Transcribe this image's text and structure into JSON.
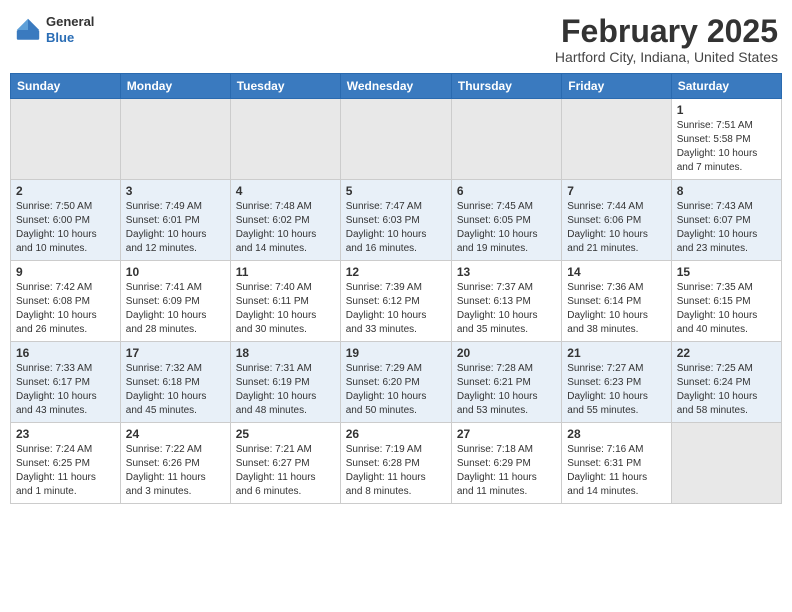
{
  "header": {
    "logo": {
      "general": "General",
      "blue": "Blue"
    },
    "title": "February 2025",
    "location": "Hartford City, Indiana, United States"
  },
  "calendar": {
    "days_of_week": [
      "Sunday",
      "Monday",
      "Tuesday",
      "Wednesday",
      "Thursday",
      "Friday",
      "Saturday"
    ],
    "weeks": [
      {
        "id": "week1",
        "days": [
          {
            "num": "",
            "info": ""
          },
          {
            "num": "",
            "info": ""
          },
          {
            "num": "",
            "info": ""
          },
          {
            "num": "",
            "info": ""
          },
          {
            "num": "",
            "info": ""
          },
          {
            "num": "",
            "info": ""
          },
          {
            "num": "1",
            "info": "Sunrise: 7:51 AM\nSunset: 5:58 PM\nDaylight: 10 hours\nand 7 minutes."
          }
        ]
      },
      {
        "id": "week2",
        "days": [
          {
            "num": "2",
            "info": "Sunrise: 7:50 AM\nSunset: 6:00 PM\nDaylight: 10 hours\nand 10 minutes."
          },
          {
            "num": "3",
            "info": "Sunrise: 7:49 AM\nSunset: 6:01 PM\nDaylight: 10 hours\nand 12 minutes."
          },
          {
            "num": "4",
            "info": "Sunrise: 7:48 AM\nSunset: 6:02 PM\nDaylight: 10 hours\nand 14 minutes."
          },
          {
            "num": "5",
            "info": "Sunrise: 7:47 AM\nSunset: 6:03 PM\nDaylight: 10 hours\nand 16 minutes."
          },
          {
            "num": "6",
            "info": "Sunrise: 7:45 AM\nSunset: 6:05 PM\nDaylight: 10 hours\nand 19 minutes."
          },
          {
            "num": "7",
            "info": "Sunrise: 7:44 AM\nSunset: 6:06 PM\nDaylight: 10 hours\nand 21 minutes."
          },
          {
            "num": "8",
            "info": "Sunrise: 7:43 AM\nSunset: 6:07 PM\nDaylight: 10 hours\nand 23 minutes."
          }
        ]
      },
      {
        "id": "week3",
        "days": [
          {
            "num": "9",
            "info": "Sunrise: 7:42 AM\nSunset: 6:08 PM\nDaylight: 10 hours\nand 26 minutes."
          },
          {
            "num": "10",
            "info": "Sunrise: 7:41 AM\nSunset: 6:09 PM\nDaylight: 10 hours\nand 28 minutes."
          },
          {
            "num": "11",
            "info": "Sunrise: 7:40 AM\nSunset: 6:11 PM\nDaylight: 10 hours\nand 30 minutes."
          },
          {
            "num": "12",
            "info": "Sunrise: 7:39 AM\nSunset: 6:12 PM\nDaylight: 10 hours\nand 33 minutes."
          },
          {
            "num": "13",
            "info": "Sunrise: 7:37 AM\nSunset: 6:13 PM\nDaylight: 10 hours\nand 35 minutes."
          },
          {
            "num": "14",
            "info": "Sunrise: 7:36 AM\nSunset: 6:14 PM\nDaylight: 10 hours\nand 38 minutes."
          },
          {
            "num": "15",
            "info": "Sunrise: 7:35 AM\nSunset: 6:15 PM\nDaylight: 10 hours\nand 40 minutes."
          }
        ]
      },
      {
        "id": "week4",
        "days": [
          {
            "num": "16",
            "info": "Sunrise: 7:33 AM\nSunset: 6:17 PM\nDaylight: 10 hours\nand 43 minutes."
          },
          {
            "num": "17",
            "info": "Sunrise: 7:32 AM\nSunset: 6:18 PM\nDaylight: 10 hours\nand 45 minutes."
          },
          {
            "num": "18",
            "info": "Sunrise: 7:31 AM\nSunset: 6:19 PM\nDaylight: 10 hours\nand 48 minutes."
          },
          {
            "num": "19",
            "info": "Sunrise: 7:29 AM\nSunset: 6:20 PM\nDaylight: 10 hours\nand 50 minutes."
          },
          {
            "num": "20",
            "info": "Sunrise: 7:28 AM\nSunset: 6:21 PM\nDaylight: 10 hours\nand 53 minutes."
          },
          {
            "num": "21",
            "info": "Sunrise: 7:27 AM\nSunset: 6:23 PM\nDaylight: 10 hours\nand 55 minutes."
          },
          {
            "num": "22",
            "info": "Sunrise: 7:25 AM\nSunset: 6:24 PM\nDaylight: 10 hours\nand 58 minutes."
          }
        ]
      },
      {
        "id": "week5",
        "days": [
          {
            "num": "23",
            "info": "Sunrise: 7:24 AM\nSunset: 6:25 PM\nDaylight: 11 hours\nand 1 minute."
          },
          {
            "num": "24",
            "info": "Sunrise: 7:22 AM\nSunset: 6:26 PM\nDaylight: 11 hours\nand 3 minutes."
          },
          {
            "num": "25",
            "info": "Sunrise: 7:21 AM\nSunset: 6:27 PM\nDaylight: 11 hours\nand 6 minutes."
          },
          {
            "num": "26",
            "info": "Sunrise: 7:19 AM\nSunset: 6:28 PM\nDaylight: 11 hours\nand 8 minutes."
          },
          {
            "num": "27",
            "info": "Sunrise: 7:18 AM\nSunset: 6:29 PM\nDaylight: 11 hours\nand 11 minutes."
          },
          {
            "num": "28",
            "info": "Sunrise: 7:16 AM\nSunset: 6:31 PM\nDaylight: 11 hours\nand 14 minutes."
          },
          {
            "num": "",
            "info": ""
          }
        ]
      }
    ]
  }
}
